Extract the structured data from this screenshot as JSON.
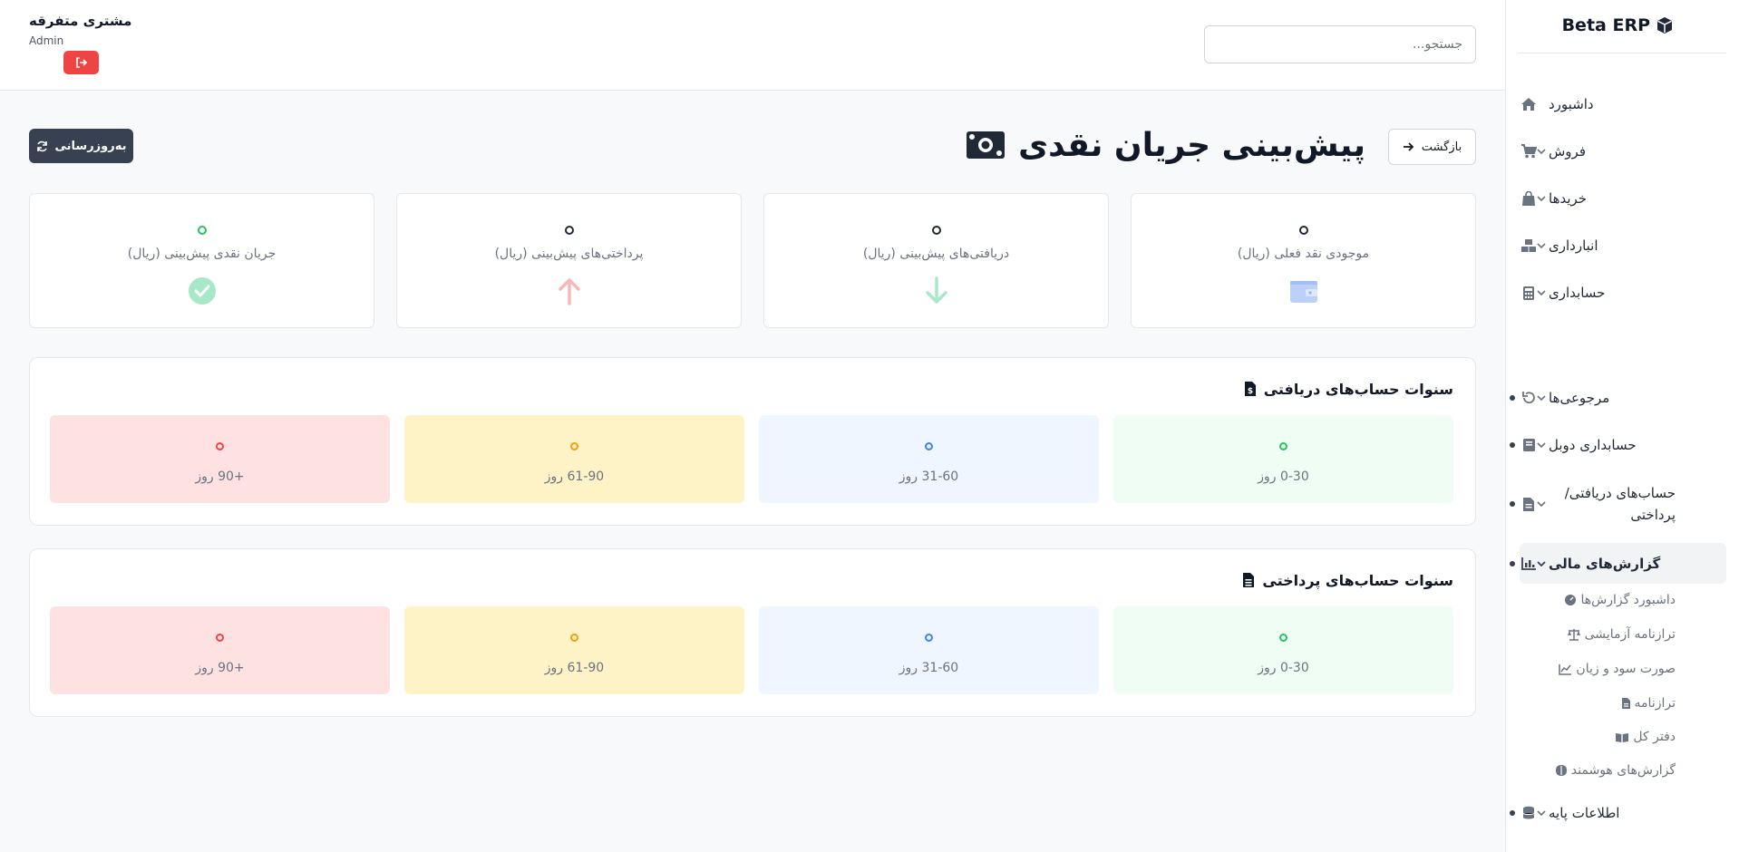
{
  "app": {
    "brand": "Beta ERP",
    "brand_icon": "cube-icon"
  },
  "header": {
    "search_placeholder": "جستجو...",
    "user_name": "مشتری متفرقه",
    "user_role": "Admin",
    "logout_icon": "sign-out-icon"
  },
  "sidebar": {
    "items": [
      {
        "label": "داشبورد",
        "icon": "home-icon"
      },
      {
        "label": "فروش",
        "icon": "cart-icon"
      },
      {
        "label": "خریدها",
        "icon": "bag-icon"
      },
      {
        "label": "انبارداری",
        "icon": "boxes-icon"
      },
      {
        "label": "حسابداری",
        "icon": "calculator-icon"
      },
      {
        "label": "مرجوعی‌ها",
        "icon": "undo-icon"
      },
      {
        "label": "حسابداری دوبل",
        "icon": "book-icon"
      },
      {
        "label": "حساب‌های دریافتی/ پرداختی",
        "icon": "invoice-icon"
      },
      {
        "label": "گزارش‌های مالی",
        "icon": "chart-icon",
        "active": true
      },
      {
        "label": "اطلاعات پایه",
        "icon": "database-icon"
      }
    ],
    "sub_items": [
      {
        "label": "داشبورد گزارش‌ها",
        "icon": "gauge-icon"
      },
      {
        "label": "ترازنامه آزمایشی",
        "icon": "scale-icon"
      },
      {
        "label": "صورت سود و زیان",
        "icon": "line-chart-icon"
      },
      {
        "label": "ترازنامه",
        "icon": "file-icon"
      },
      {
        "label": "دفتر کل",
        "icon": "open-book-icon"
      },
      {
        "label": "گزارش‌های هوشمند",
        "icon": "brain-icon"
      }
    ]
  },
  "page": {
    "title": "پیش‌بینی جریان نقدی",
    "title_icon": "money-bill-icon",
    "back_label": "بازگشت",
    "refresh_label": "به‌روزرسانی"
  },
  "summary_cards": [
    {
      "label": "موجودی نقد فعلی (ریال)",
      "icon": "wallet-icon",
      "color": "#93b4f5"
    },
    {
      "label": "دریافتی‌های پیش‌بینی (ریال)",
      "icon": "arrow-down-icon",
      "color": "#a7e8c9"
    },
    {
      "label": "پرداختی‌های پیش‌بینی (ریال)",
      "icon": "arrow-up-icon",
      "color": "#f9b8b8"
    },
    {
      "label": "جریان نقدی پیش‌بینی (ریال)",
      "icon": "check-circle-icon",
      "color": "#a7e8c9"
    }
  ],
  "receivables": {
    "title": "سنوات حساب‌های دریافتی",
    "title_icon": "invoice-dollar-icon",
    "buckets": [
      {
        "label": "0-30 روز",
        "color": "#22c55e"
      },
      {
        "label": "31-60 روز",
        "color": "#3b82f6"
      },
      {
        "label": "61-90 روز",
        "color": "#f59e0b"
      },
      {
        "label": "+90 روز",
        "color": "#ef4444"
      }
    ]
  },
  "payables": {
    "title": "سنوات حساب‌های پرداختی",
    "title_icon": "invoice-icon",
    "buckets": [
      {
        "label": "0-30 روز",
        "color": "#22c55e"
      },
      {
        "label": "31-60 روز",
        "color": "#3b82f6"
      },
      {
        "label": "61-90 روز",
        "color": "#f59e0b"
      },
      {
        "label": "+90 روز",
        "color": "#ef4444"
      }
    ]
  }
}
